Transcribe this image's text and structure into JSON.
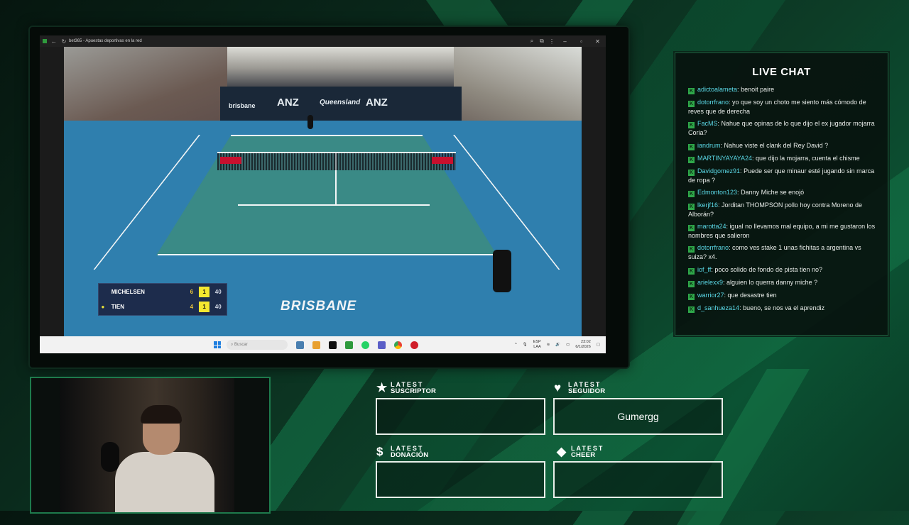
{
  "browser": {
    "title": "bet365 - Apuestas deportivas en la red"
  },
  "scoreboard": {
    "players": [
      {
        "name": "MICHELSEN",
        "sets": "6",
        "current": "1",
        "points": "40",
        "serving": false
      },
      {
        "name": "TIEN",
        "sets": "4",
        "current": "1",
        "points": "40",
        "serving": true
      }
    ]
  },
  "video": {
    "location": "BRISBANE",
    "banners": [
      "brisbane",
      "ANZ",
      "Queensland",
      "ANZ"
    ]
  },
  "taskbar": {
    "search_placeholder": "Buscar",
    "lang_line1": "ESP",
    "lang_line2": "LAA",
    "time": "23:02",
    "date": "6/1/2026"
  },
  "chat": {
    "title": "LIVE CHAT",
    "badge": "K",
    "messages": [
      {
        "user": "adictoalameta",
        "text": "benoit paire"
      },
      {
        "user": "dotorrfrano",
        "text": "yo que soy un choto me siento más cómodo de reves que de derecha"
      },
      {
        "user": "FacMS",
        "text": "Nahue que opinas de lo que dijo el ex jugador mojarra Coria?"
      },
      {
        "user": "iandrum",
        "text": "Nahue viste el clank del Rey David ?"
      },
      {
        "user": "MARTINYAYAYA24",
        "text": "que dijo la mojarra, cuenta el chisme"
      },
      {
        "user": "Davidgomez91",
        "text": "Puede ser que minaur esté jugando sin marca de ropa ?"
      },
      {
        "user": "Edmonton123",
        "text": "Danny Miche se enojó"
      },
      {
        "user": "lkerjf16",
        "text": "Jorditan THOMPSON pollo hoy contra Moreno de Alborán?"
      },
      {
        "user": "marotta24",
        "text": "igual no llevamos mal equipo, a mi me gustaron los nombres que salieron"
      },
      {
        "user": "dotorrfrano",
        "text": "como ves stake 1 unas fichitas a argentina vs suiza? x4."
      },
      {
        "user": "iof_ff",
        "text": "poco solido de fondo de pista tien no?"
      },
      {
        "user": "arielexx9",
        "text": "alguien lo querra danny miche ?"
      },
      {
        "user": "warrior27",
        "text": "que desastre tien"
      },
      {
        "user": "d_sanhueza14",
        "text": "bueno, se nos va el aprendiz"
      }
    ]
  },
  "alerts": {
    "suscriptor": {
      "line1": "LATEST",
      "line2": "SUSCRIPTOR",
      "value": ""
    },
    "seguidor": {
      "line1": "LATEST",
      "line2": "SEGUIDOR",
      "value": "Gumergg"
    },
    "donacion": {
      "line1": "LATEST",
      "line2": "DONACIÓN",
      "value": ""
    },
    "cheer": {
      "line1": "LATEST",
      "line2": "CHEER",
      "value": ""
    }
  },
  "colors": {
    "accent": "#1e7a4c",
    "chat_user": "#5bd8e6",
    "badge": "#2fa84a",
    "score_highlight": "#f4e730"
  }
}
